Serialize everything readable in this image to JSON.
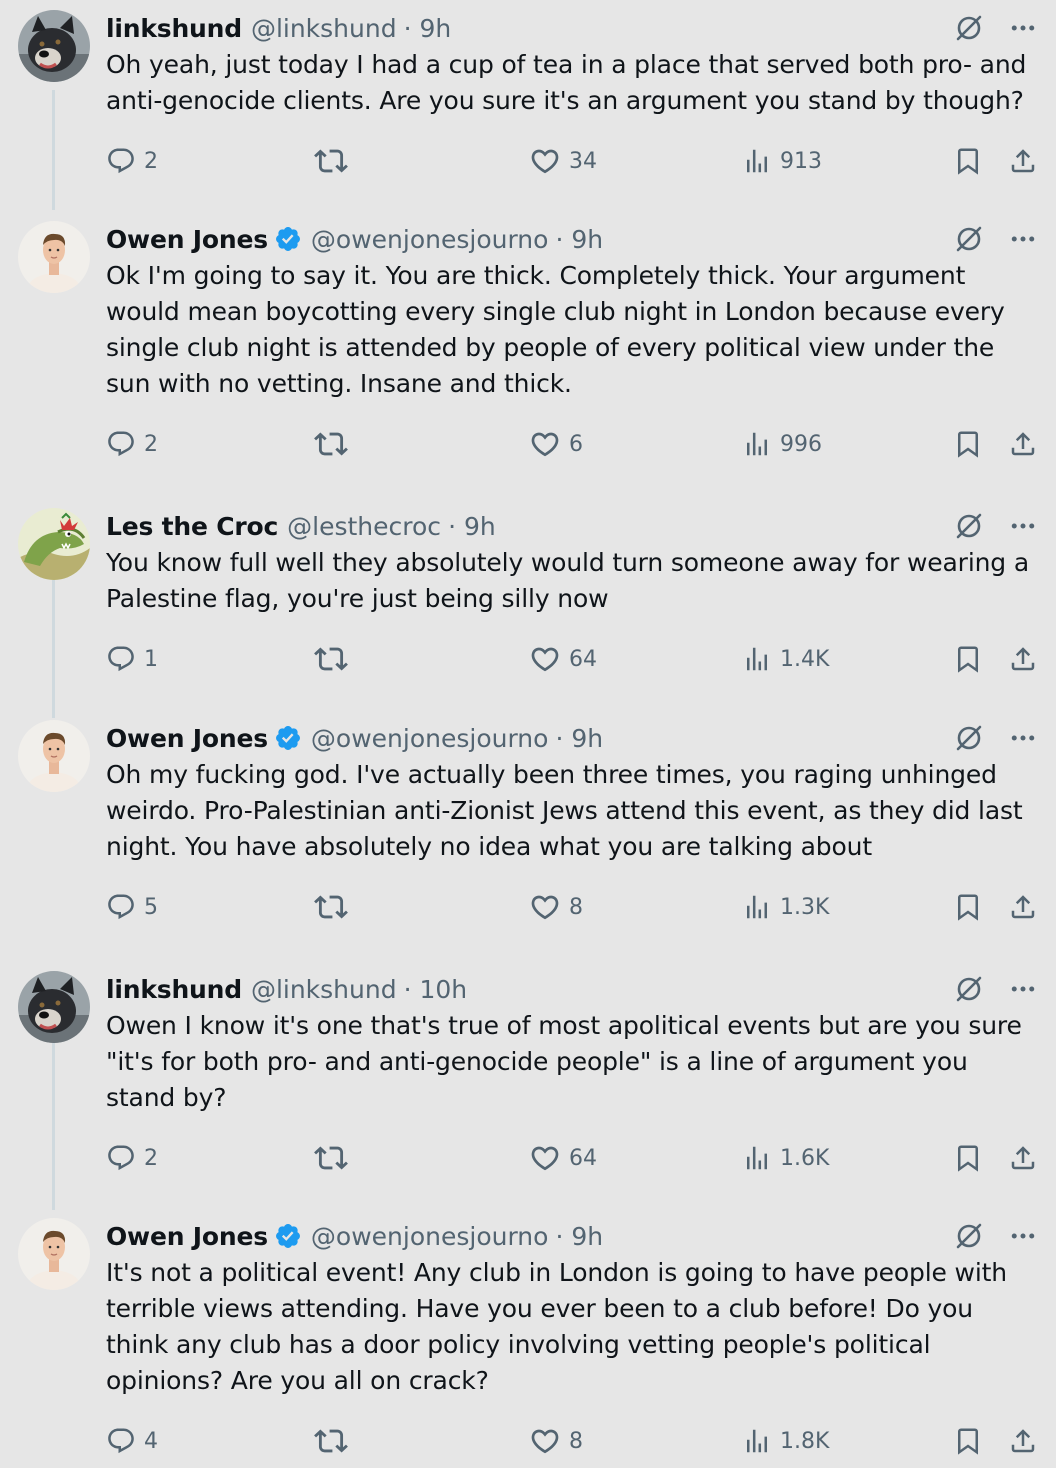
{
  "tweets": [
    {
      "name": "linkshund",
      "handle": "@linkshund",
      "time": "· 9h",
      "verified": false,
      "avatar": "dog-avatar",
      "text": "Oh yeah, just today I had a cup of tea in a place that served both pro- and anti-genocide clients. Are you sure it's an argument you stand by though?",
      "replies": "2",
      "retweets": "",
      "likes": "34",
      "views": "913"
    },
    {
      "name": "Owen Jones",
      "handle": "@owenjonesjourno",
      "time": "· 9h",
      "verified": true,
      "avatar": "man-avatar",
      "text": "Ok I'm going to say it. You are thick. Completely thick. Your argument would mean boycotting every single club night in London because every single club night is attended by people of every political view under the sun with no vetting. Insane and thick.",
      "replies": "2",
      "retweets": "",
      "likes": "6",
      "views": "996"
    },
    {
      "name": "Les the Croc",
      "handle": "@lesthecroc",
      "time": "· 9h",
      "verified": false,
      "avatar": "croc-avatar",
      "text": "You know full well they absolutely would turn someone away for wearing a Palestine flag, you're just being silly now",
      "replies": "1",
      "retweets": "",
      "likes": "64",
      "views": "1.4K"
    },
    {
      "name": "Owen Jones",
      "handle": "@owenjonesjourno",
      "time": "· 9h",
      "verified": true,
      "avatar": "man-avatar",
      "text": "Oh my fucking god. I've actually been three times, you raging unhinged weirdo. Pro-Palestinian anti-Zionist Jews attend this event, as they did last night. You have absolutely no idea what you are talking about",
      "replies": "5",
      "retweets": "",
      "likes": "8",
      "views": "1.3K"
    },
    {
      "name": "linkshund",
      "handle": "@linkshund",
      "time": "· 10h",
      "verified": false,
      "avatar": "dog-avatar",
      "text": "Owen I know it's one that's true of most apolitical events but are you sure \"it's for both pro- and anti-genocide people\" is a line of argument you stand by?",
      "replies": "2",
      "retweets": "",
      "likes": "64",
      "views": "1.6K"
    },
    {
      "name": "Owen Jones",
      "handle": "@owenjonesjourno",
      "time": "· 9h",
      "verified": true,
      "avatar": "man-avatar",
      "text": "It's not a political event! Any club in London is going to have people with terrible views attending. Have you ever been to a club before! Do you think any club has a door policy involving vetting people's political opinions? Are you all on crack?",
      "replies": "4",
      "retweets": "",
      "likes": "8",
      "views": "1.8K"
    }
  ],
  "colors": {
    "background": "#e6e6e6",
    "text": "#0f1419",
    "secondary": "#536471",
    "verified": "#1d9bf0",
    "thread_line": "#cfd9de"
  }
}
